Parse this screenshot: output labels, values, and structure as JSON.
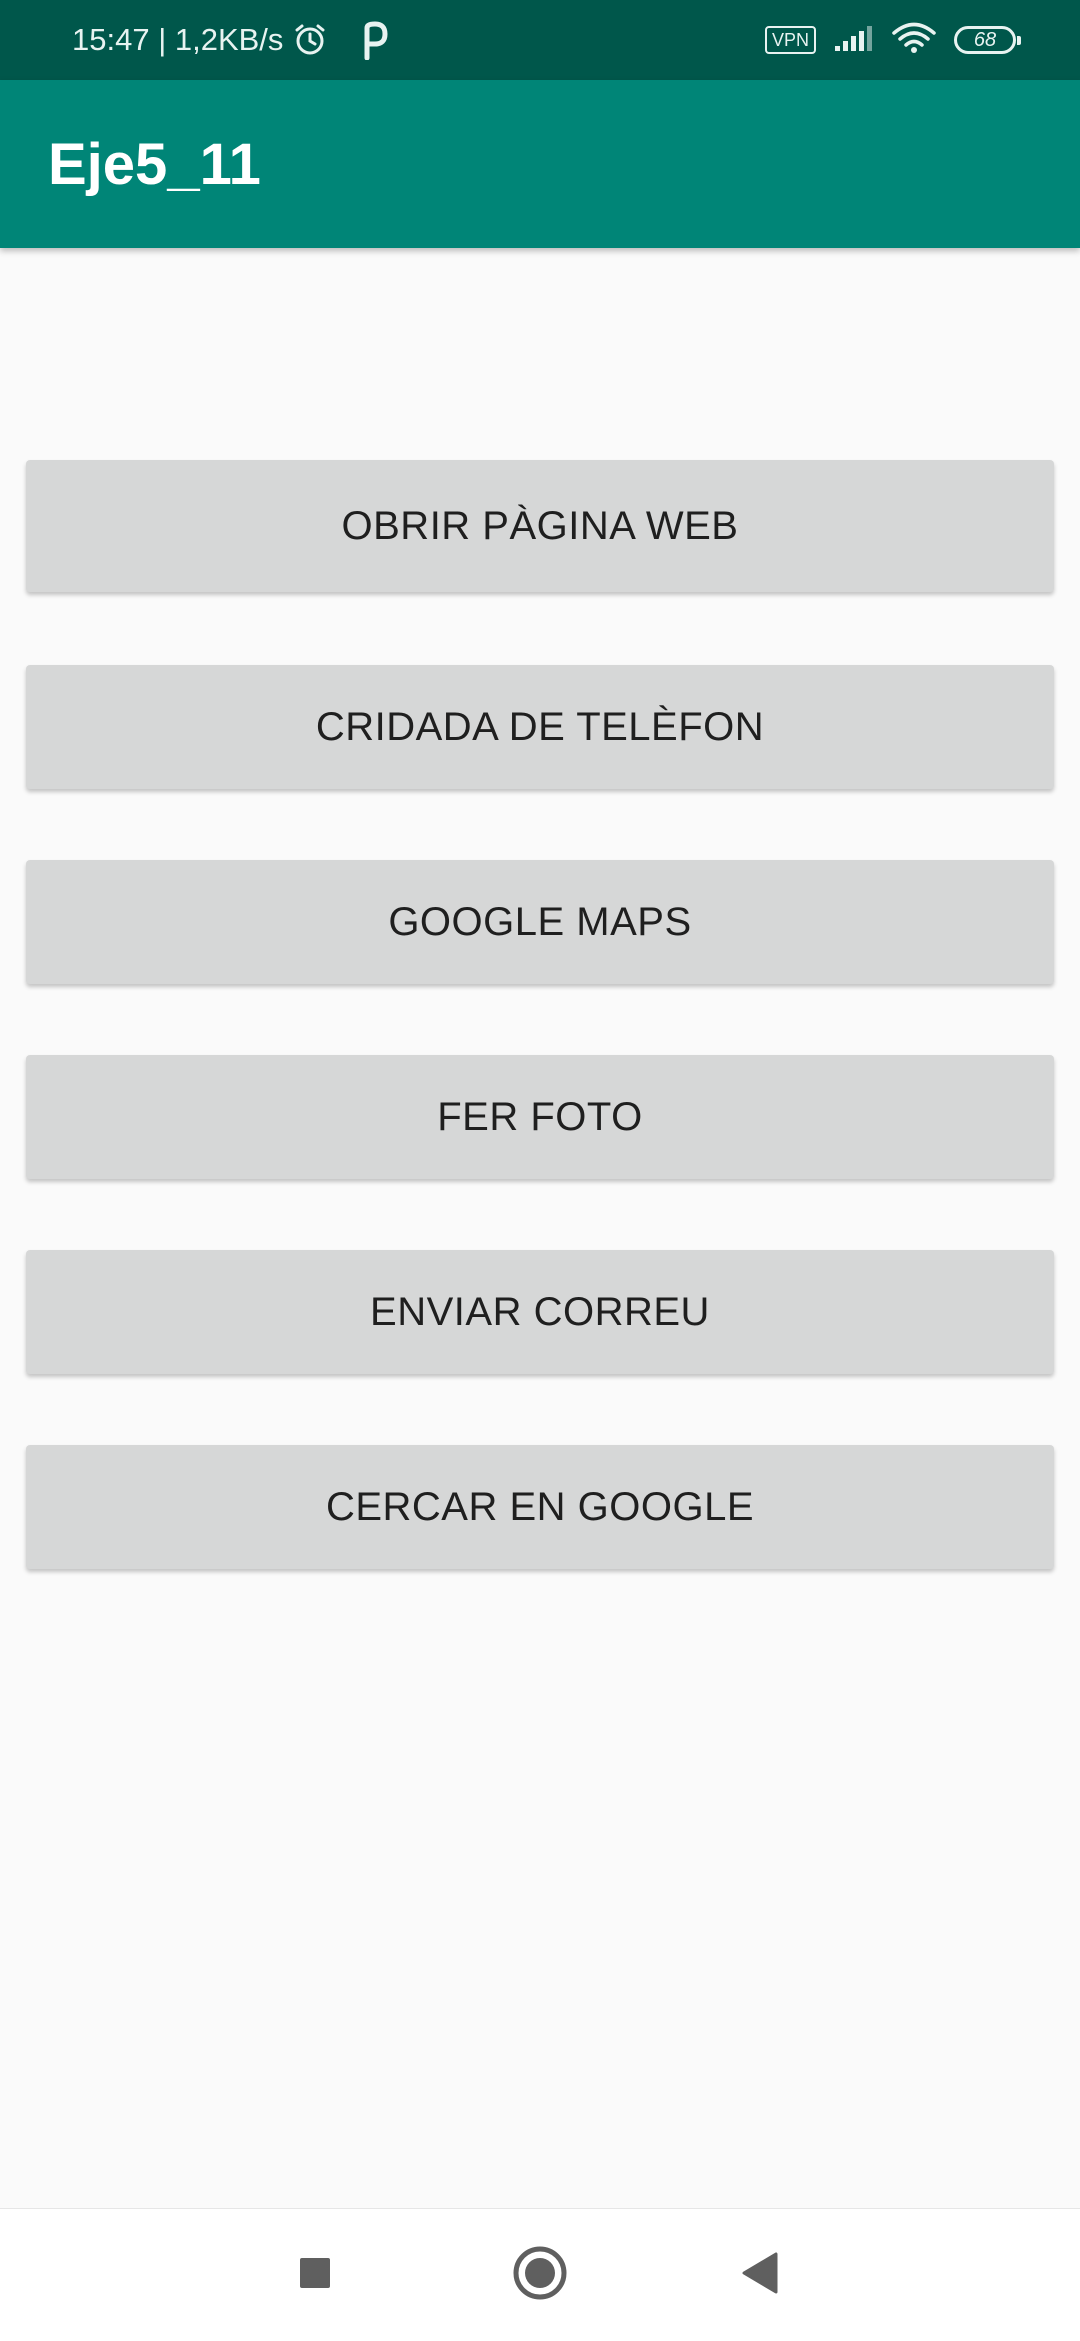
{
  "status_bar": {
    "time_speed": "15:47 | 1,2KB/s",
    "alarm_icon": "alarm-clock-icon",
    "app_notification_icon": "p-notification-icon",
    "vpn_label": "VPN",
    "battery_level": "68"
  },
  "app_bar": {
    "title": "Eje5_11"
  },
  "buttons": [
    {
      "label": "OBRIR PÀGINA WEB"
    },
    {
      "label": "CRIDADA DE TELÈFON"
    },
    {
      "label": "GOOGLE MAPS"
    },
    {
      "label": "FER FOTO"
    },
    {
      "label": "ENVIAR CORREU"
    },
    {
      "label": "CERCAR EN GOOGLE"
    }
  ],
  "nav_bar": {
    "recents_icon": "square-recents-icon",
    "home_icon": "circle-home-icon",
    "back_icon": "triangle-back-icon"
  },
  "colors": {
    "status_bar": "#00574b",
    "app_bar": "#008577",
    "button": "#d6d7d7",
    "background": "#fafafa"
  }
}
